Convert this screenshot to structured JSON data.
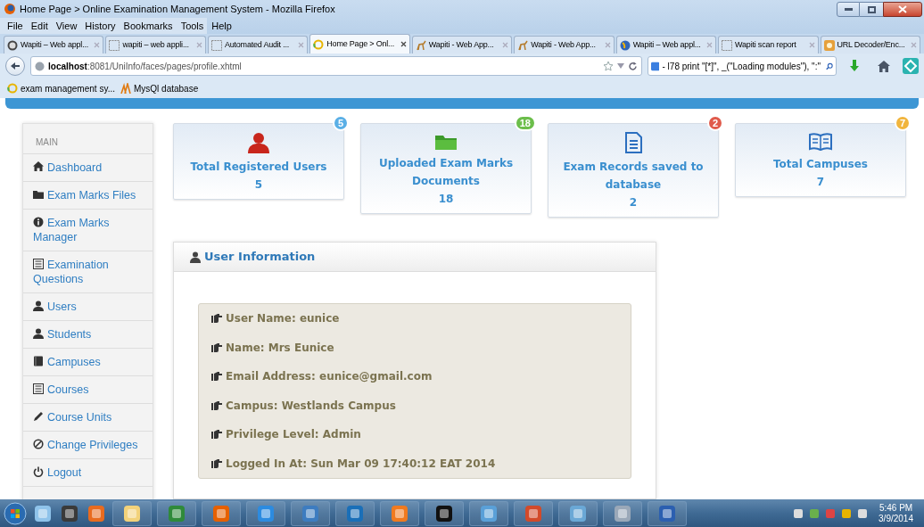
{
  "window": {
    "title": "Home Page > Online Examination Management System - Mozilla Firefox"
  },
  "menu": [
    "File",
    "Edit",
    "View",
    "History",
    "Bookmarks",
    "Tools",
    "Help"
  ],
  "tabs": [
    {
      "label": "Wapiti – Web appl...",
      "selected": false
    },
    {
      "label": "wapiti – web appli...",
      "selected": false
    },
    {
      "label": "Automated Audit ...",
      "selected": false
    },
    {
      "label": "Home Page > Onl...",
      "selected": true
    },
    {
      "label": "Wapiti - Web App...",
      "selected": false
    },
    {
      "label": "Wapiti - Web App...",
      "selected": false
    },
    {
      "label": "Wapiti – Web appl...",
      "selected": false
    },
    {
      "label": "Wapiti scan report",
      "selected": false
    },
    {
      "label": "URL Decoder/Enc...",
      "selected": false
    }
  ],
  "address_bar": {
    "host": "localhost",
    "rest": ":8081/UniInfo/faces/pages/profile.xhtml"
  },
  "search_box": {
    "value": "- l78   print \"[*]\", _(\"Loading modules\"), \":\""
  },
  "bookmarks": [
    "exam management sy...",
    "MysQl database"
  ],
  "sidebar": {
    "heading": "MAIN",
    "items": [
      "Dashboard",
      "Exam Marks Files",
      "Exam Marks Manager",
      "Examination Questions",
      "Users",
      "Students",
      "Campuses",
      "Courses",
      "Course Units",
      "Change Privileges",
      "Logout"
    ]
  },
  "cards": [
    {
      "title": "Total Registered Users",
      "value": "5",
      "badge": "5",
      "color": "#5aafe6"
    },
    {
      "title": "Uploaded Exam Marks Documents",
      "value": "18",
      "badge": "18",
      "color": "#6cbe4b"
    },
    {
      "title": "Exam Records saved to database",
      "value": "2",
      "badge": "2",
      "color": "#e05a4b"
    },
    {
      "title": "Total Campuses",
      "value": "7",
      "badge": "7",
      "color": "#f1b53d"
    }
  ],
  "user_panel": {
    "title": "User Information",
    "lines": [
      "User Name: eunice",
      "Name: Mrs Eunice",
      "Email Address: eunice@gmail.com",
      "Campus: Westlands Campus",
      "Privilege Level: Admin",
      "Logged In At: Sun Mar 09 17:40:12 EAT 2014"
    ]
  },
  "clock": {
    "time": "5:46 PM",
    "date": "3/9/2014"
  }
}
